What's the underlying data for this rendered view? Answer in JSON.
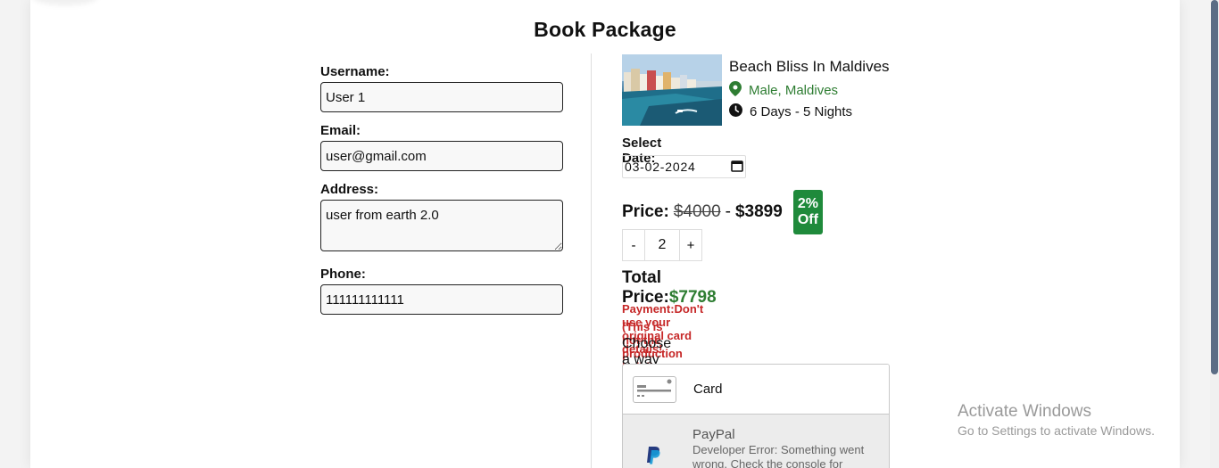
{
  "page_title": "Book Package",
  "form": {
    "username_label": "Username:",
    "username_value": "User 1",
    "email_label": "Email:",
    "email_value": "user@gmail.com",
    "address_label": "Address:",
    "address_value": "user from earth 2.0",
    "phone_label": "Phone:",
    "phone_value": "111111111111"
  },
  "package": {
    "name": "Beach Bliss In Maldives",
    "location": "Male, Maldives",
    "duration": "6 Days - 5 Nights",
    "location_icon": "map-pin-icon",
    "duration_icon": "clock-icon",
    "location_color": "#2e7d32"
  },
  "booking": {
    "select_date_label": "Select Date:",
    "date_value": "03-02-2024",
    "price_label": "Price:",
    "regular_price": "$4000",
    "separator": "-",
    "discount_price": "$3899",
    "discount_badge": "2% Off",
    "badge_color": "#1f8a3b",
    "decrement_label": "-",
    "quantity": "2",
    "increment_label": "+",
    "total_label": "Total Price:",
    "total_value": "$7798"
  },
  "payment": {
    "warning_line1": "Payment:Don't use your original card details!",
    "warning_line2": "(This is not the production build)",
    "choose_label": "Choose a way to pay",
    "card_label": "Card",
    "paypal_label": "PayPal",
    "paypal_error": "Developer Error: Something went wrong. Check the console for"
  },
  "os_watermark": {
    "line1": "Activate Windows",
    "line2": "Go to Settings to activate Windows."
  }
}
